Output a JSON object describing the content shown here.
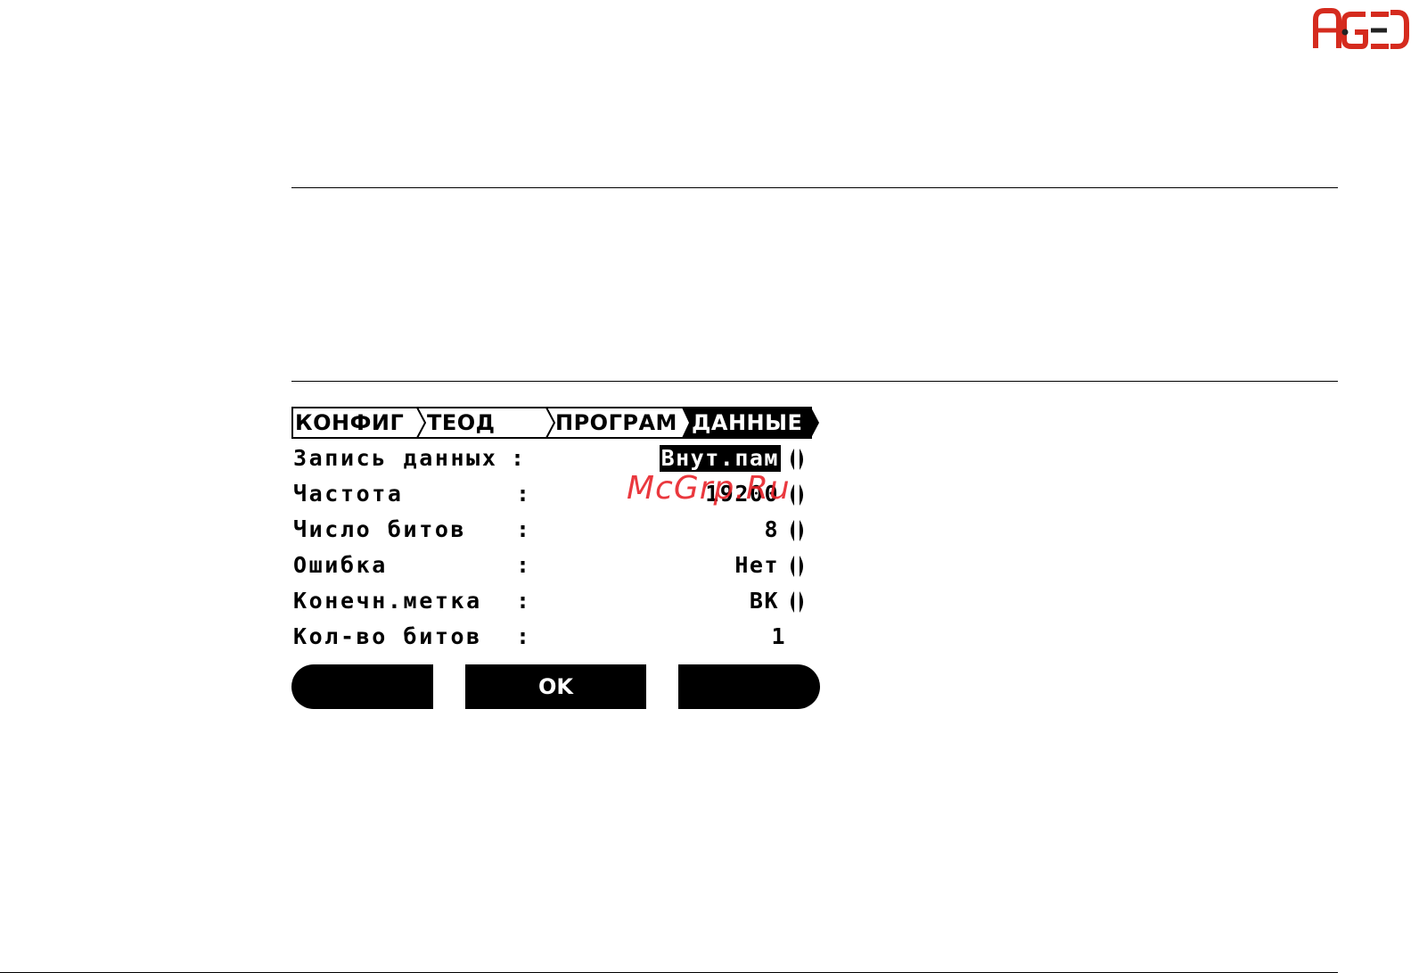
{
  "logo": {
    "text": "AGED",
    "color": "#d52b1e"
  },
  "tabs": [
    {
      "label": "КОНФИГ",
      "active": false
    },
    {
      "label": "ТЕОД",
      "active": false
    },
    {
      "label": "ПРОГРАМ",
      "active": false
    },
    {
      "label": "ДАННЫЕ",
      "active": true
    }
  ],
  "rows": [
    {
      "label": "Запись данных",
      "colon": ":",
      "value": "Внут.пам",
      "selected": true,
      "arrows": true
    },
    {
      "label": "Частота",
      "colon": ":",
      "value": "19200",
      "selected": false,
      "arrows": true
    },
    {
      "label": "Число битов",
      "colon": ":",
      "value": "8",
      "selected": false,
      "arrows": true
    },
    {
      "label": "Ошибка",
      "colon": ":",
      "value": "Нет",
      "selected": false,
      "arrows": true
    },
    {
      "label": "Конечн.метка",
      "colon": ":",
      "value": "ВК",
      "selected": false,
      "arrows": true
    },
    {
      "label": "Кол-во битов",
      "colon": ":",
      "value": "1",
      "selected": false,
      "arrows": false
    }
  ],
  "softkeys": {
    "left": "",
    "middle": "OK",
    "right": ""
  },
  "watermark": {
    "text": "McGrp.Ru",
    "color": "#e8232a"
  }
}
